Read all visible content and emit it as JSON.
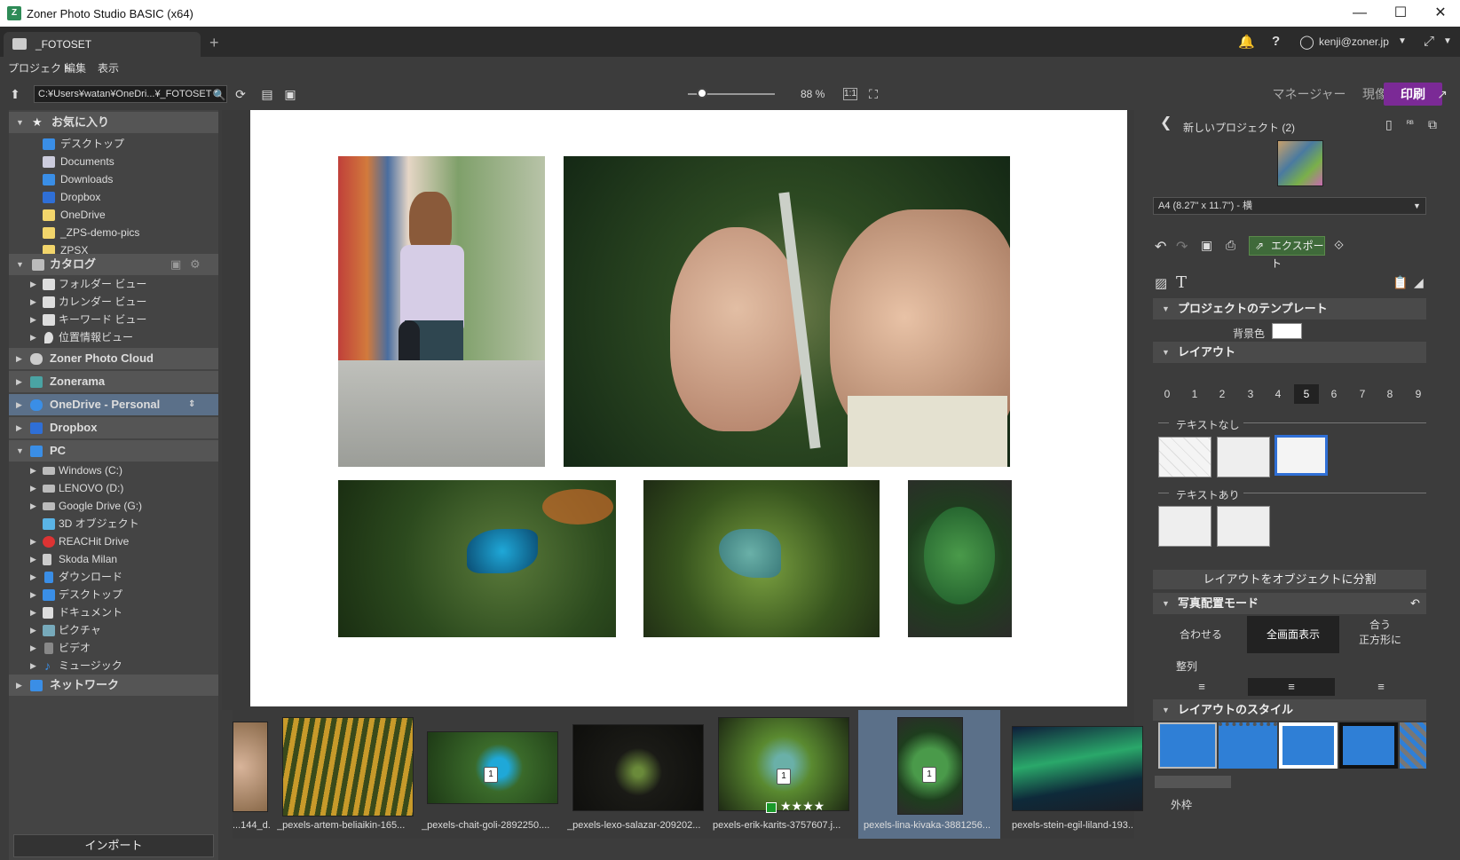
{
  "window": {
    "title": "Zoner Photo Studio BASIC (x64)",
    "minimize": "—",
    "maximize": "☐",
    "close": "✕"
  },
  "tabs": [
    {
      "label": "_FOTOSET"
    }
  ],
  "tab_add": "+",
  "account": {
    "email": "kenji@zoner.jp"
  },
  "menu": [
    "プロジェクト",
    "編集",
    "表示"
  ],
  "toolbar": {
    "path": "C:¥Users¥watan¥OneDri...¥_FOTOSET",
    "zoom": "88 %"
  },
  "modes": {
    "manager": "マネージャー",
    "develop": "現像",
    "print": "印刷"
  },
  "sidebar": {
    "favorites_title": "お気に入り",
    "favorites": [
      "デスクトップ",
      "Documents",
      "Downloads",
      "Dropbox",
      "OneDrive",
      "_ZPS-demo-pics",
      "ZPSX"
    ],
    "catalog_title": "カタログ",
    "catalog": [
      "フォルダー ビュー",
      "カレンダー ビュー",
      "キーワード ビュー",
      "位置情報ビュー"
    ],
    "services": [
      "Zoner Photo Cloud",
      "Zonerama",
      "OneDrive - Personal",
      "Dropbox"
    ],
    "pc_title": "PC",
    "pc": [
      "Windows (C:)",
      "LENOVO (D:)",
      "Google Drive (G:)",
      "3D オブジェクト",
      "REACHit Drive",
      "Skoda Milan",
      "ダウンロード",
      "デスクトップ",
      "ドキュメント",
      "ピクチャ",
      "ビデオ",
      "ミュージック"
    ],
    "network": "ネットワーク",
    "import": "インポート"
  },
  "filmstrip": [
    {
      "name": "...144_d...",
      "badge": ""
    },
    {
      "name": "_pexels-artem-beliaikin-165...",
      "badge": ""
    },
    {
      "name": "_pexels-chait-goli-2892250....",
      "badge": "1"
    },
    {
      "name": "_pexels-lexo-salazar-209202...",
      "badge": ""
    },
    {
      "name": "pexels-erik-karits-3757607.j...",
      "badge": "1",
      "stars": "★★★★"
    },
    {
      "name": "pexels-lina-kivaka-3881256...",
      "badge": "1"
    },
    {
      "name": "pexels-stein-egil-liland-193...",
      "badge": ""
    }
  ],
  "panel": {
    "project_name": "新しいプロジェクト (2)",
    "paper": "A4 (8.27\" x 11.7\") - 横",
    "export": "エクスポート",
    "template_title": "プロジェクトのテンプレート",
    "bg_label": "背景色",
    "layout_title": "レイアウト",
    "layout_numbers": [
      "0",
      "1",
      "2",
      "3",
      "4",
      "5",
      "6",
      "7",
      "8",
      "9"
    ],
    "selected_number": "5",
    "no_text": "テキストなし",
    "with_text": "テキストあり",
    "split_button": "レイアウトをオブジェクトに分割",
    "placement_title": "写真配置モード",
    "placement": [
      "合わせる",
      "全画面表示",
      "合う\n正方形に"
    ],
    "align_title": "整列",
    "style_title": "レイアウトのスタイル",
    "frame_title": "外枠"
  }
}
